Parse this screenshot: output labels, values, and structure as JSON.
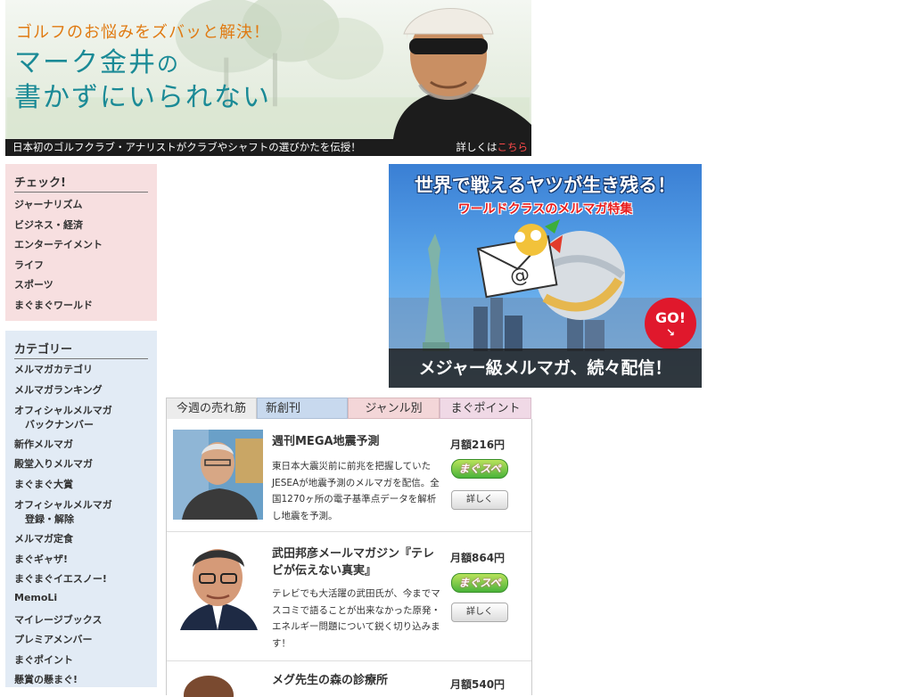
{
  "banner": {
    "tagline": "ゴルフのお悩みをズバッと解決！",
    "title_line1": "マーク金井",
    "title_no": "の",
    "title_line2": "書かずにいられない",
    "footer_left": "日本初のゴルフクラブ・アナリストがクラブやシャフトの選びかたを伝授！",
    "footer_more": "詳しくは",
    "footer_link": "こちら"
  },
  "sidebar": {
    "check": {
      "heading": "チェック!",
      "items": [
        "ジャーナリズム",
        "ビジネス・経済",
        "エンターテイメント",
        "ライフ",
        "スポーツ",
        "まぐまぐワールド"
      ]
    },
    "category": {
      "heading": "カテゴリー",
      "items": [
        {
          "label": "メルマガカテゴリ"
        },
        {
          "label": "メルマガランキング"
        },
        {
          "label": "オフィシャルメルマガ",
          "sub": "バックナンバー"
        },
        {
          "label": "新作メルマガ"
        },
        {
          "label": "殿堂入りメルマガ"
        },
        {
          "label": "まぐまぐ大賞"
        },
        {
          "label": "オフィシャルメルマガ",
          "sub": "登録・解除"
        },
        {
          "label": "メルマガ定食"
        },
        {
          "label": "まぐギャザ!"
        },
        {
          "label": "まぐまぐイエスノー!"
        },
        {
          "label": "MemoLi"
        },
        {
          "label": "マイレージブックス"
        },
        {
          "label": "プレミアメンバー"
        },
        {
          "label": "まぐポイント"
        },
        {
          "label": "懸賞の懸まぐ!"
        }
      ]
    }
  },
  "ad": {
    "headline": "世界で戦えるヤツが生き残る！",
    "subhead": "ワールドクラスのメルマガ特集",
    "go": "GO!",
    "bottom": "メジャー級メルマガ、続々配信！"
  },
  "tabs": [
    "今週の売れ筋",
    "新創刊",
    "ジャンル別",
    "まぐポイント"
  ],
  "items": [
    {
      "title": "週刊MEGA地震予測",
      "price": "月額216円",
      "badge": "まぐスペ",
      "desc": "東日本大震災前に前兆を把握していたJESEAが地震予測のメルマガを配信。全国1270ヶ所の電子基準点データを解析し地震を予測。",
      "button": "詳しく"
    },
    {
      "title": "武田邦彦メールマガジン『テレビが伝えない真実』",
      "price": "月額864円",
      "badge": "まぐスペ",
      "desc": "テレビでも大活躍の武田氏が、今までマスコミで語ることが出来なかった原発・エネルギー問題について鋭く切り込みます！",
      "button": "詳しく"
    },
    {
      "title": "メグ先生の森の診療所",
      "price": "月額540円"
    }
  ]
}
